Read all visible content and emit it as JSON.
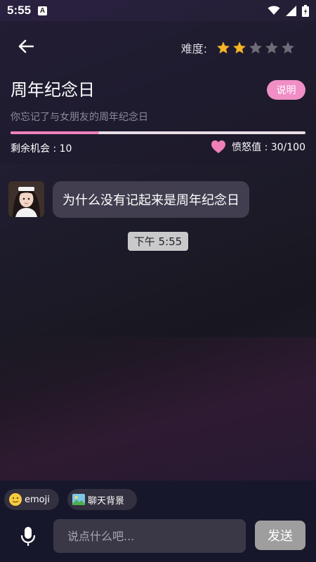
{
  "status_bar": {
    "time": "5:55",
    "badge": "A"
  },
  "header": {
    "difficulty_label": "难度:",
    "difficulty_rating": 2,
    "difficulty_max": 5,
    "title": "周年纪念日",
    "explain_label": "说明",
    "subtitle": "你忘记了与女朋友的周年纪念日",
    "progress_fraction": 0.3,
    "chances_text": "剩余机会 : 10",
    "anger_text": "愤怒值 : 30/100"
  },
  "chat": {
    "messages": [
      {
        "text": "为什么没有记起来是周年纪念日"
      }
    ],
    "time_label": "下午 5:55"
  },
  "toolbar": {
    "emoji_label": "emoji",
    "background_label": "聊天背景",
    "input_placeholder": "说点什么吧...",
    "send_label": "发送"
  },
  "colors": {
    "accent_pink": "#f08ec6",
    "star_active": "#f4b425",
    "star_inactive": "#6f6c78",
    "heart": "#f07fb8"
  },
  "icons": [
    "back-arrow-icon",
    "star-icon",
    "heart-icon",
    "emoji-icon",
    "image-icon",
    "microphone-icon",
    "wifi-icon",
    "signal-icon",
    "battery-icon"
  ]
}
